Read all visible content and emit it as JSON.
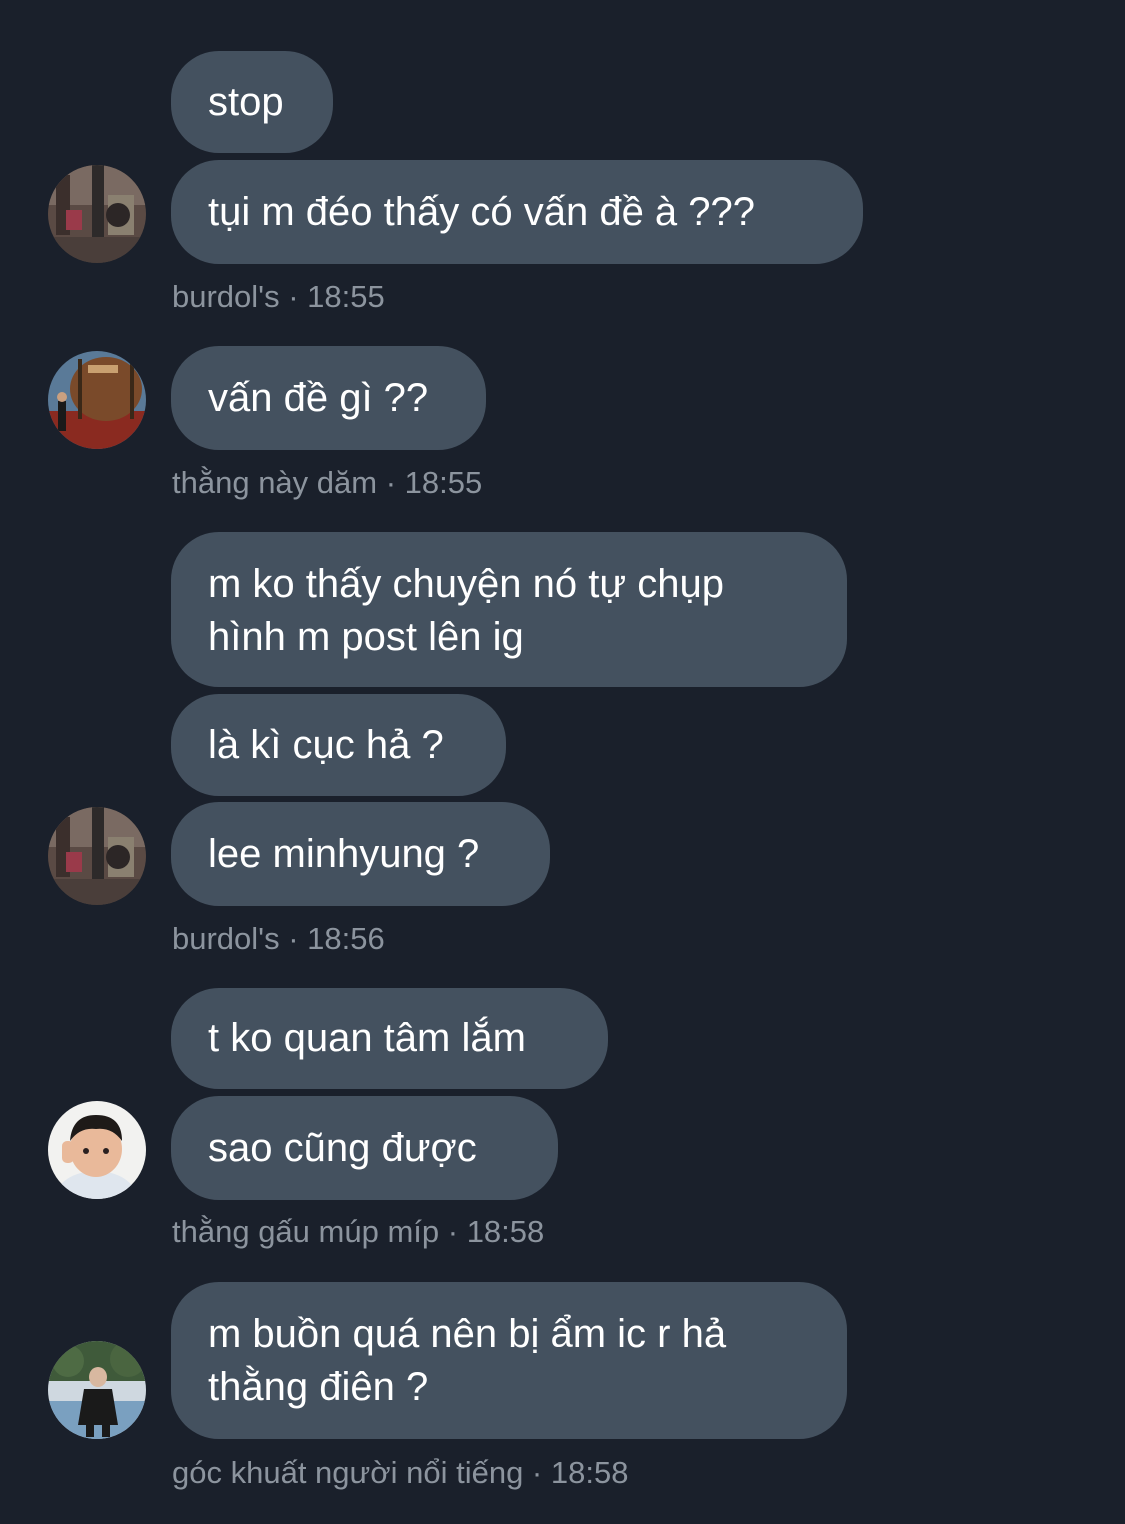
{
  "groups": [
    {
      "messages": [
        "stop",
        "tụi m đéo thấy có vấn đề à ???"
      ],
      "sender": "burdol's",
      "time": "18:55",
      "avatar": "photo-avatar-burdols"
    },
    {
      "messages": [
        "vấn đề gì ??"
      ],
      "sender": "thằng này dăm",
      "time": "18:55",
      "avatar": "photo-avatar-barrel"
    },
    {
      "messages": [
        [
          "m ko thấy chuyện nó tự chụp",
          "hình m post lên ig"
        ],
        "là kì cục hả ?",
        "lee minhyung ?"
      ],
      "sender": "burdol's",
      "time": "18:56",
      "avatar": "photo-avatar-burdols"
    },
    {
      "messages": [
        "t ko quan tâm lắm",
        "sao cũng được"
      ],
      "sender": "thằng gấu múp míp",
      "time": "18:58",
      "avatar": "photo-avatar-child"
    },
    {
      "messages": [
        [
          "m buồn quá nên bị ẩm ic r hả",
          "thằng điên ?"
        ]
      ],
      "sender": "góc khuất người nổi tiếng",
      "time": "18:58",
      "avatar": "photo-avatar-park"
    }
  ],
  "meta_separator": " · ",
  "colors": {
    "background": "#1a202b",
    "bubble": "#44515f",
    "bubble_text": "#ffffff",
    "meta_text": "#8c949e"
  }
}
